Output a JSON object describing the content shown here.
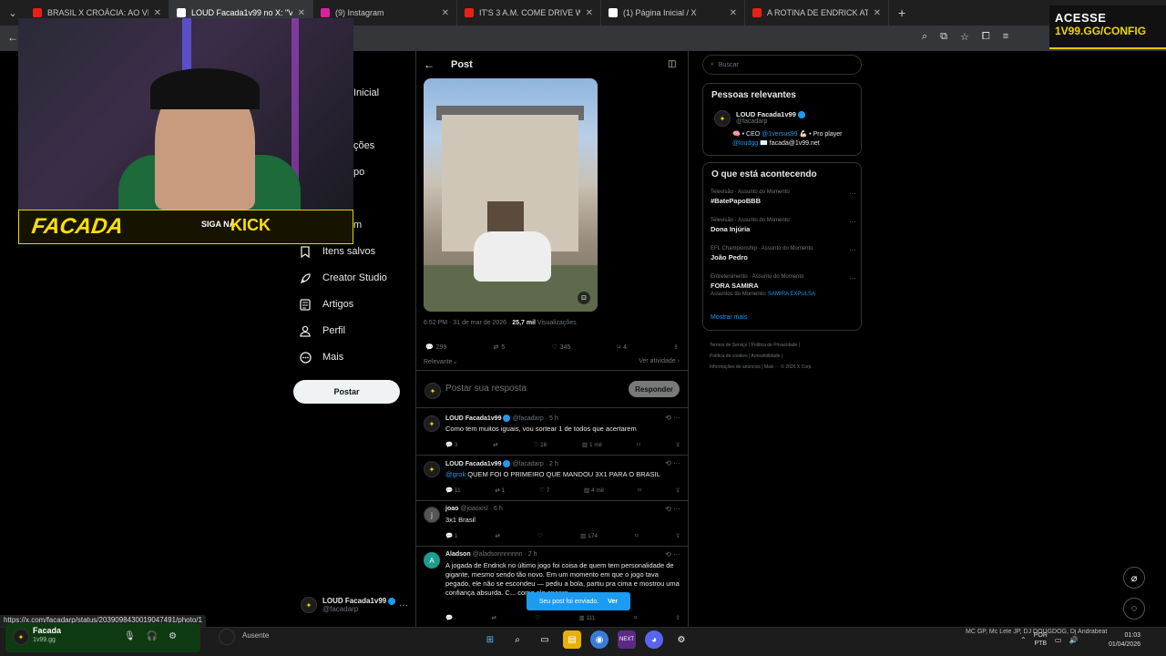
{
  "browser": {
    "tabs": [
      {
        "title": "BRASIL X CROÁCIA: AO VIVO E",
        "color": "#e62117",
        "active": false
      },
      {
        "title": "LOUD Facada1v99 no X: \"Vou s",
        "color": "#ffffff",
        "active": true
      },
      {
        "title": "(9) Instagram",
        "color": "#d6249f",
        "active": false
      },
      {
        "title": "IT'S 3 A.M. COME DRIVE WITH M",
        "color": "#e62117",
        "active": false
      },
      {
        "title": "(1) Página Inicial / X",
        "color": "#ffffff",
        "active": false
      },
      {
        "title": "A ROTINA DE ENDRICK ATÉ A S",
        "color": "#e62117",
        "active": false
      }
    ],
    "new_tab": "+",
    "status_url": "https://x.com/facadarp/status/2039098430019047491/photo/1"
  },
  "ad": {
    "line1": "ACESSE",
    "line2": "1V99.GG/CONFIG"
  },
  "stream_banner": {
    "brand": "FACADA",
    "siga_na": "SIGA NA",
    "kick": "KICK"
  },
  "left_nav": {
    "partial_items": [
      "Inicial",
      "ções",
      "po",
      "m"
    ],
    "items": [
      {
        "icon": "bookmark-icon",
        "label": "Itens salvos"
      },
      {
        "icon": "rocket-icon",
        "label": "Creator Studio"
      },
      {
        "icon": "article-icon",
        "label": "Artigos"
      },
      {
        "icon": "person-icon",
        "label": "Perfil"
      },
      {
        "icon": "more-icon",
        "label": "Mais"
      }
    ],
    "post_button": "Postar",
    "account": {
      "name": "LOUD Facada1v99",
      "handle": "@facadarp"
    }
  },
  "post": {
    "header": "Post",
    "timestamp": "6:52 PM · 31 de mar de 2026 · ",
    "views_count": "25,7 mil",
    "views_label": " Visualizações",
    "stats": {
      "replies": "299",
      "reposts": "5",
      "likes": "345",
      "bookmarks": "4"
    },
    "sort_label": "Relevante",
    "activity_label": "Ver atividade",
    "reply_placeholder": "Postar sua resposta",
    "reply_button": "Responder"
  },
  "replies": [
    {
      "name": "LOUD Facada1v99",
      "handle": "@facadarp · 5 h",
      "mention": "",
      "text": "Como tem muitos iguais, vou sortear 1 de todos que acertarem",
      "stats": {
        "replies": "3",
        "reposts": "",
        "likes": "16",
        "views": "1 mil"
      }
    },
    {
      "name": "LOUD Facada1v99",
      "handle": "@facadarp · 2 h",
      "mention": "@grok",
      "text": " QUEM FOI O PRIMEIRO QUE MANDOU 3X1 PARA O BRASIL",
      "stats": {
        "replies": "11",
        "reposts": "1",
        "likes": "7",
        "views": "4 mil"
      }
    },
    {
      "name": "joao",
      "handle": "@joaoxisl · 6 h",
      "mention": "",
      "text": "3x1 Brasil",
      "stats": {
        "replies": "1",
        "reposts": "",
        "likes": "",
        "views": "174"
      }
    },
    {
      "name": "Aladson",
      "handle": "@aladsonnnnnnn · 2 h",
      "mention": "",
      "text": "A jogada de Endrick no último jogo foi coisa de quem tem personalidade de gigante, mesmo sendo tão novo. Em um momento em que o jogo tava pegado, ele não se escondeu — pediu a bola, partiu pra cima e mostrou uma confiança absurda. C... como ele encaro",
      "stats": {
        "replies": "",
        "reposts": "",
        "likes": "",
        "views": "111"
      }
    }
  ],
  "toast": {
    "text": "Seu post foi enviado.",
    "action": "Ver"
  },
  "right": {
    "search_placeholder": "Buscar",
    "relevant_title": "Pessoas relevantes",
    "relevant_user": {
      "name": "LOUD Facada1v99",
      "handle": "@facadarp",
      "bio_1": "🧠 • CEO ",
      "bio_mention_1": "@1versus99",
      "bio_2": " 💪🏻 • Pro player",
      "bio_mention_2": "@loudgg",
      "bio_3": " ✉️ facada@1v99.net"
    },
    "trends_title": "O que está acontecendo",
    "trends": [
      {
        "category": "Televisão · Assunto do Momento",
        "title": "#BatePapoBBB",
        "sub_label": "",
        "sub_link": ""
      },
      {
        "category": "Televisão · Assunto do Momento",
        "title": "Dona Injúria",
        "sub_label": "",
        "sub_link": ""
      },
      {
        "category": "EFL Championship · Assunto do Momento",
        "title": "João Pedro",
        "sub_label": "",
        "sub_link": ""
      },
      {
        "category": "Entretenimento · Assunto do Momento",
        "title": "FORA SAMIRA",
        "sub_label": "Assuntos do Momento: ",
        "sub_link": "SAMIRA EXPULSA"
      }
    ],
    "show_more": "Mostrar mais",
    "footer_line1": "Termos de Serviço  |  Política de Privacidade  |",
    "footer_line2": "Política de cookies  |  Acessibilidade  |",
    "footer_line3": "Informações de anúncios  |  Mais ···  © 2026 X Corp."
  },
  "taskbar": {
    "kick_name": "Facada",
    "kick_sub": "1v99.gg",
    "user_status": "Ausente",
    "music": "MC GP, Mc Lele JP, DJ DOUGDOG, Dj Andrabeat",
    "lang_1": "POR",
    "lang_2": "PTB",
    "time": "01:03",
    "date": "01/04/2026"
  }
}
